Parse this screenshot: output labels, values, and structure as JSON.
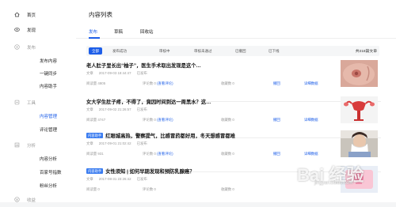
{
  "sidebar": {
    "items": [
      {
        "label": "首页",
        "icon": "home-icon",
        "kind": "top"
      },
      {
        "label": "发现",
        "icon": "eye-icon",
        "kind": "top"
      },
      {
        "label": "发布",
        "icon": "compass-icon",
        "kind": "group"
      },
      {
        "label": "发布内容",
        "kind": "sub"
      },
      {
        "label": "一键同步",
        "kind": "sub"
      },
      {
        "label": "内容助手",
        "kind": "sub"
      },
      {
        "label": "工具",
        "icon": "tool-icon",
        "kind": "group"
      },
      {
        "label": "内容管理",
        "kind": "sub",
        "active": true
      },
      {
        "label": "评论管理",
        "kind": "sub"
      },
      {
        "label": "分析",
        "icon": "analytics-icon",
        "kind": "group"
      },
      {
        "label": "内容分析",
        "kind": "sub"
      },
      {
        "label": "百家号指数",
        "kind": "sub"
      },
      {
        "label": "粉丝分析",
        "kind": "sub"
      },
      {
        "label": "收益",
        "icon": "income-icon",
        "kind": "group"
      }
    ]
  },
  "main": {
    "title": "内容列表",
    "tabs": [
      {
        "label": "发布",
        "active": true
      },
      {
        "label": "草稿"
      },
      {
        "label": "回收站"
      }
    ],
    "filters": [
      "全部",
      "发布成功",
      "审核中",
      "审核未通过",
      "已撤回",
      "已下线"
    ],
    "total_count": "共218篇文章",
    "articles": [
      {
        "title": "老人肚子里长出“柚子”，医生手术取出发现是这个…",
        "badge": "",
        "type": "文章",
        "date": "2017-09-03 18:44:47",
        "status": "已发布",
        "reads": "阅读量 4805",
        "comments": "评论数 0",
        "comments_link": "(查看评论)",
        "favorites": "收藏数 0",
        "actions": [
          "撤回",
          "详细数据"
        ],
        "thumb": "skin"
      },
      {
        "title": "女大学生肚子疼，不得了，竟因时间到达一周黑水？这…",
        "badge": "",
        "type": "文章",
        "date": "2017-09-02 21:26:57",
        "status": "已发布",
        "reads": "阅读量 4747",
        "comments": "评论数 0",
        "comments_link": "(查看评论)",
        "favorites": "收藏数 0",
        "actions": [
          "撤回",
          "详细数据"
        ],
        "thumb": "uterus"
      },
      {
        "title": "红眼城高热，警察提气，比感冒药都好用，冬天想感冒都难",
        "badge": "内容助手",
        "type": "文章",
        "date": "2017-09-01 21:02:42",
        "status": "已发布",
        "reads": "阅读量 931",
        "comments": "评论数 0",
        "comments_link": "(查看评论)",
        "favorites": "收藏数 0",
        "actions": [
          "撤回",
          "详细数据"
        ],
        "thumb": "sick"
      },
      {
        "title": "女性须知 | 如何早期发现和预防乳腺癌？",
        "badge": "内容助手",
        "type": "文章",
        "date": "2017-08-31 23:26:42",
        "status": "已发布",
        "reads": "阅读量 0",
        "comments": "评论数 0",
        "comments_link": "",
        "favorites": "收藏数 0",
        "actions": [
          "撤回",
          "详细数据"
        ],
        "thumb": "icon"
      }
    ]
  },
  "watermark": {
    "brand": "Bai 经验",
    "sub": "jingyan.baidu.com"
  }
}
